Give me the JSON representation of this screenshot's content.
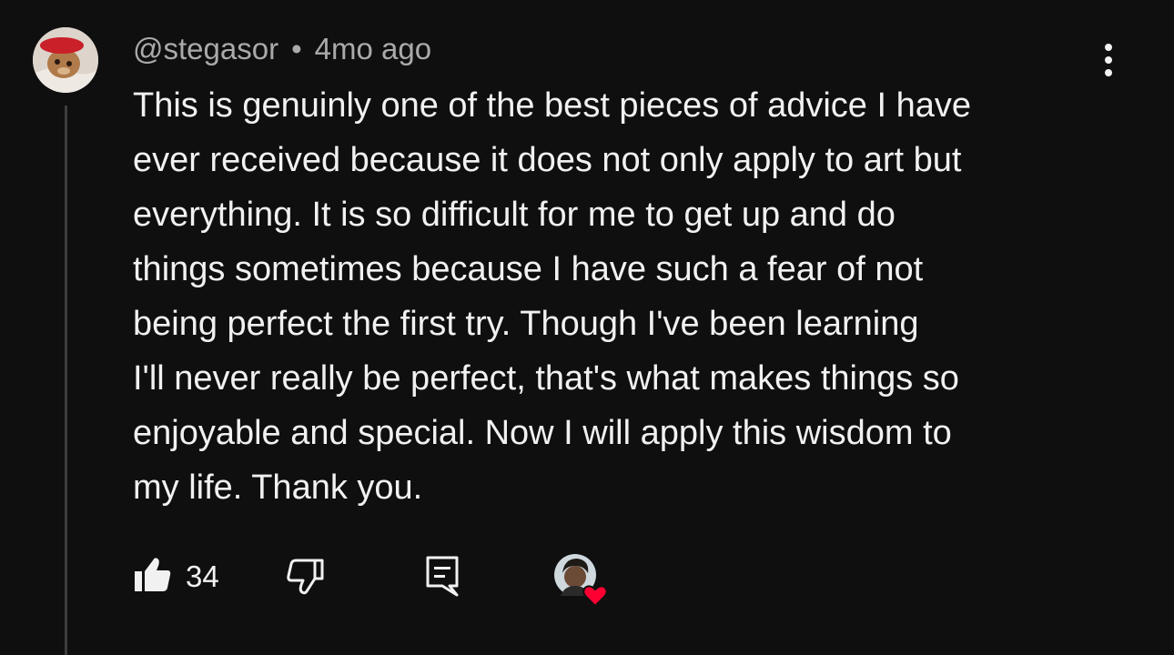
{
  "comment": {
    "author": "@stegasor",
    "separator": "•",
    "timestamp": "4mo ago",
    "avatar_icon": "user-avatar-icon",
    "text_lines": [
      "This is genuinly one of the best pieces of advice I have",
      "ever received because it does not only apply to art but",
      "everything. It is so difficult for me to get up and do",
      "things sometimes because I have such a fear of not",
      "being perfect the first try. Though I've been learning",
      "I'll never really be perfect, that's what makes things so",
      "enjoyable and special. Now I will apply this wisdom to",
      "my life. Thank you."
    ]
  },
  "actions": {
    "like_count": "34",
    "like_icon": "thumbs-up-icon",
    "dislike_icon": "thumbs-down-icon",
    "reply_icon": "reply-icon",
    "creator_heart_icon": "creator-heart-icon",
    "more_icon": "more-vertical-icon"
  },
  "colors": {
    "background": "#0f0f0f",
    "text_primary": "#f1f1f1",
    "text_secondary": "#aaaaaa",
    "thread_line": "#3d3d3d",
    "heart": "#ff0033"
  }
}
